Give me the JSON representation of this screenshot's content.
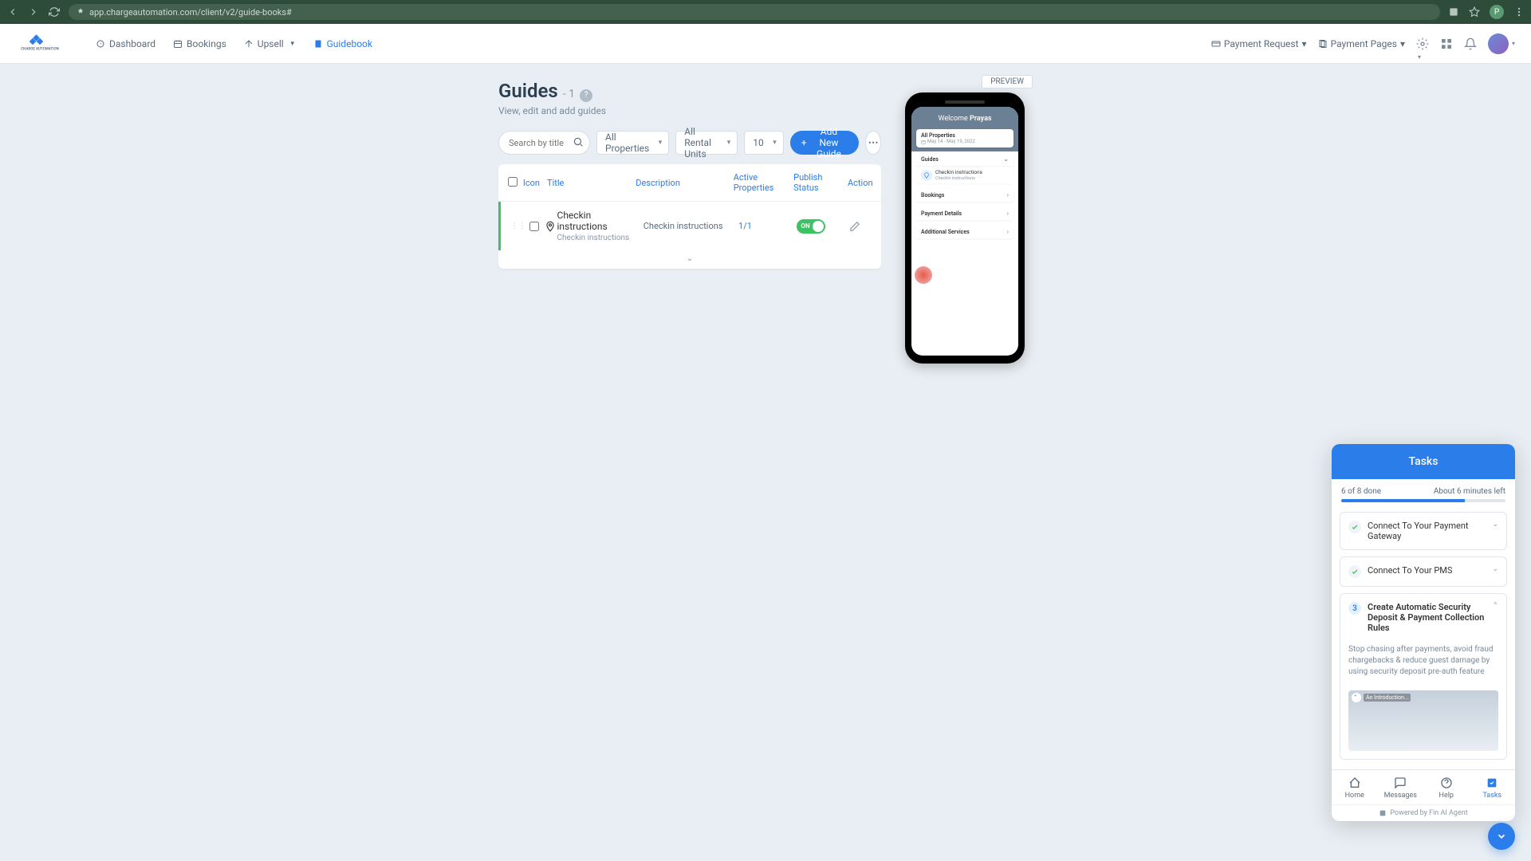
{
  "browser": {
    "url": "app.chargeautomation.com/client/v2/guide-books#"
  },
  "nav": {
    "links": [
      {
        "label": "Dashboard",
        "icon": "dashboard-icon"
      },
      {
        "label": "Bookings",
        "icon": "bookings-icon"
      },
      {
        "label": "Upsell",
        "icon": "upsell-icon",
        "caret": true
      },
      {
        "label": "Guidebook",
        "icon": "guidebook-icon",
        "active": true
      }
    ],
    "right": {
      "payment_request": "Payment Request",
      "payment_pages": "Payment Pages"
    }
  },
  "page": {
    "title": "Guides",
    "count": "- 1",
    "subtitle": "View, edit and add guides"
  },
  "filters": {
    "search_placeholder": "Search by title",
    "properties": "All Properties",
    "rental_units": "All Rental Units",
    "page_size": "10",
    "add_button": "Add New Guide"
  },
  "table": {
    "headers": {
      "icon": "Icon",
      "title": "Title",
      "description": "Description",
      "active": "Active Properties",
      "status": "Publish Status",
      "action": "Action"
    },
    "rows": [
      {
        "title": "Checkin instructions",
        "subtitle": "Checkin instructions",
        "description": "Checkin instructions",
        "active_properties": "1/1",
        "toggle_state": "ON"
      }
    ]
  },
  "preview": {
    "label": "PREVIEW",
    "welcome_prefix": "Welcome ",
    "welcome_name": "Prayas",
    "card_title": "All Properties",
    "card_dates": "May 14 - May 19, 2022",
    "sections": {
      "guides": "Guides",
      "bookings": "Bookings",
      "payment": "Payment Details",
      "additional": "Additional Services"
    },
    "guide_item": {
      "title": "Checkin instructions",
      "sub": "Checkin instructions"
    }
  },
  "tasks": {
    "header": "Tasks",
    "progress_text": "6 of 8 done",
    "time_left": "About 6 minutes left",
    "progress_percent": 75,
    "items": [
      {
        "done": true,
        "label": "Connect To Your Payment Gateway"
      },
      {
        "done": true,
        "label": "Connect To Your PMS"
      },
      {
        "done": false,
        "num": "3",
        "label": "Create Automatic Security Deposit & Payment Collection Rules",
        "detail": "Stop chasing after payments, avoid fraud chargebacks & reduce guest damage by using security deposit pre-auth feature",
        "video_title": "An Introduction..."
      }
    ],
    "nav": [
      {
        "label": "Home",
        "icon": "home"
      },
      {
        "label": "Messages",
        "icon": "messages"
      },
      {
        "label": "Help",
        "icon": "help"
      },
      {
        "label": "Tasks",
        "icon": "tasks",
        "active": true
      }
    ],
    "footer": "Powered by Fin AI Agent"
  }
}
